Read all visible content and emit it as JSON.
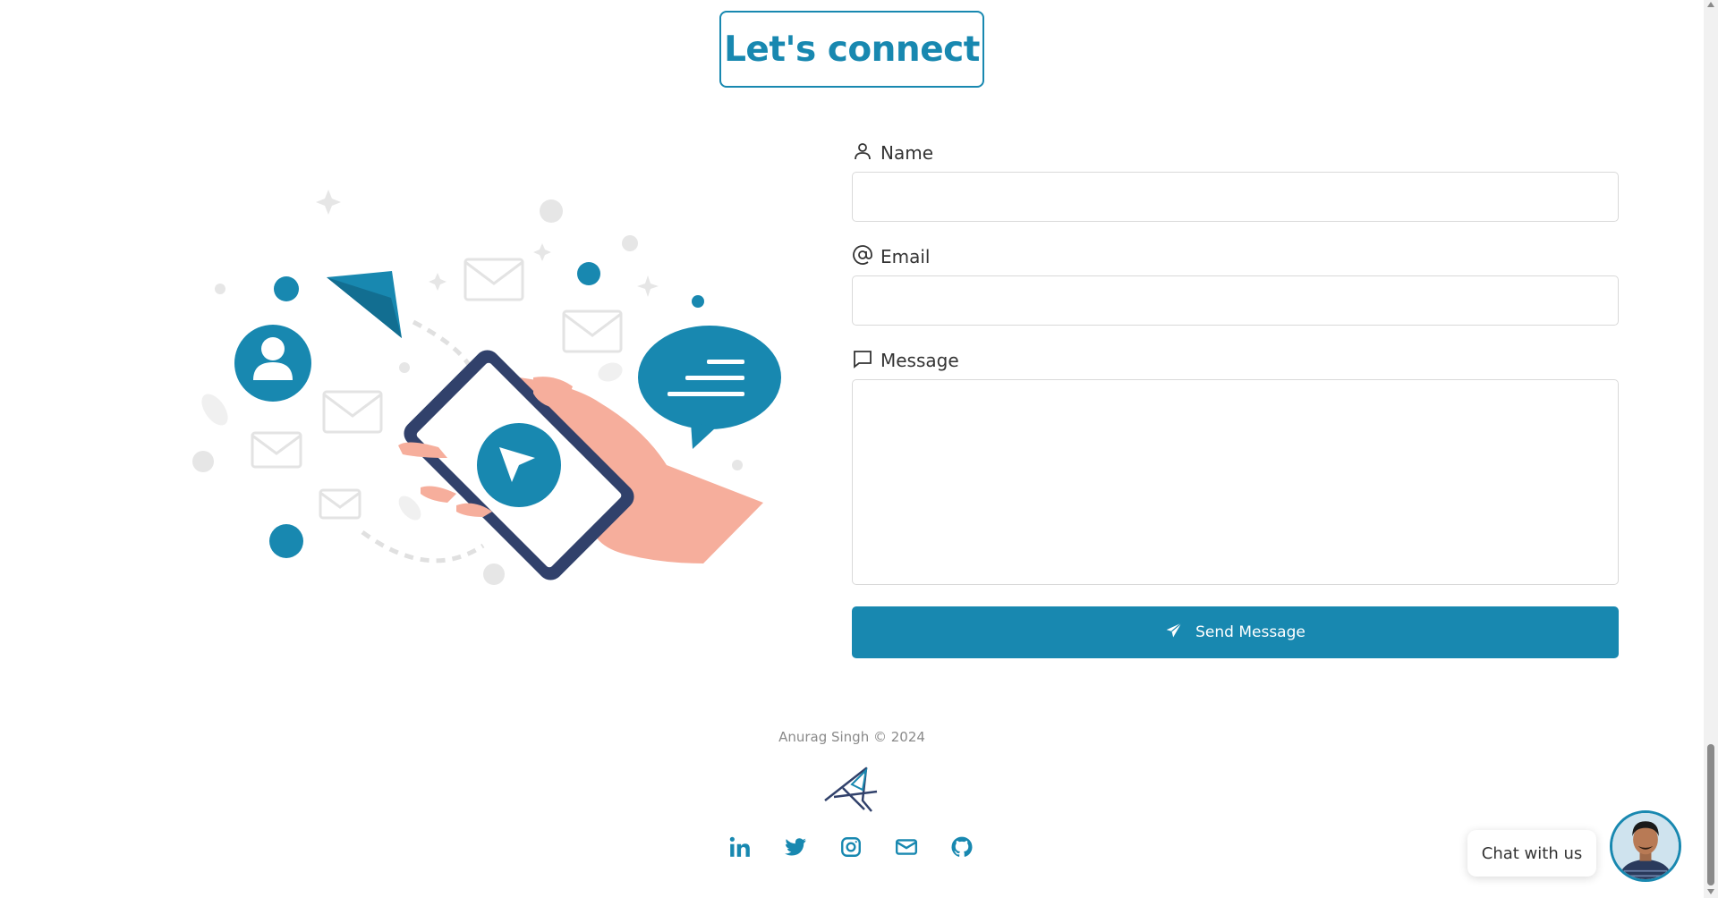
{
  "header": {
    "title": "Let's connect"
  },
  "form": {
    "name": {
      "label": "Name",
      "value": "",
      "icon": "user-icon"
    },
    "email": {
      "label": "Email",
      "value": "",
      "icon": "at-icon"
    },
    "message": {
      "label": "Message",
      "value": "",
      "icon": "message-icon"
    },
    "submit_label": "Send Message",
    "submit_icon": "paper-plane-icon"
  },
  "footer": {
    "copyright": "Anurag Singh © 2024",
    "socials": [
      "linkedin-icon",
      "twitter-icon",
      "instagram-icon",
      "mail-icon",
      "github-icon"
    ]
  },
  "chat": {
    "label": "Chat with us"
  },
  "colors": {
    "accent": "#1888b0",
    "skin": "#f6ae9c",
    "phone_frame": "#31416b",
    "muted": "#e6e6e6"
  }
}
